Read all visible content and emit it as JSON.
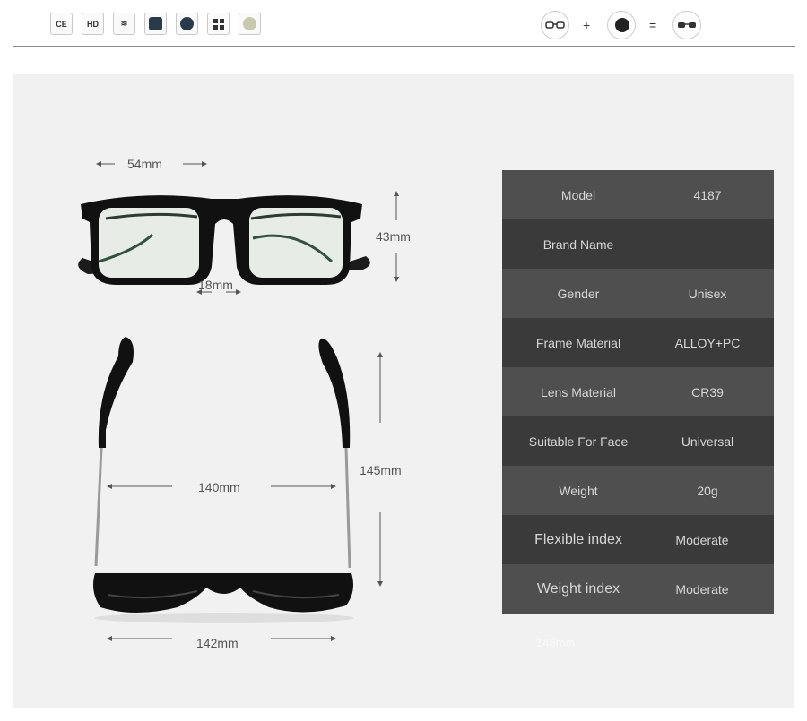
{
  "header": {
    "badges": [
      {
        "icon": "ce-mark-icon",
        "text": "CE"
      },
      {
        "icon": "hd-icon",
        "text": "HD"
      },
      {
        "icon": "wave-icon",
        "text": "≋"
      },
      {
        "icon": "shield-icon",
        "text": ""
      },
      {
        "icon": "uv-protect-icon",
        "text": ""
      },
      {
        "icon": "windows-icon",
        "text": ""
      },
      {
        "icon": "lens-disc-icon",
        "text": ""
      }
    ],
    "formula": {
      "plus": "+",
      "equals": "="
    }
  },
  "dimensions": {
    "lens_width": "54mm",
    "lens_height": "43mm",
    "bridge": "18mm",
    "temple_width": "140mm",
    "temple_length": "145mm",
    "frame_width": "142mm",
    "faded_label": "148mm"
  },
  "specs": [
    {
      "label": "Model",
      "value": "4187"
    },
    {
      "label": "Brand Name",
      "value": ""
    },
    {
      "label": "Gender",
      "value": "Unisex"
    },
    {
      "label": "Frame Material",
      "value": "ALLOY+PC"
    },
    {
      "label": "Lens Material",
      "value": "CR39"
    },
    {
      "label": "Suitable For Face",
      "value": "Universal"
    },
    {
      "label": "Weight",
      "value": "20g"
    },
    {
      "label": "Flexible index",
      "value": "Moderate"
    },
    {
      "label": "Weight index",
      "value": "Moderate"
    }
  ]
}
